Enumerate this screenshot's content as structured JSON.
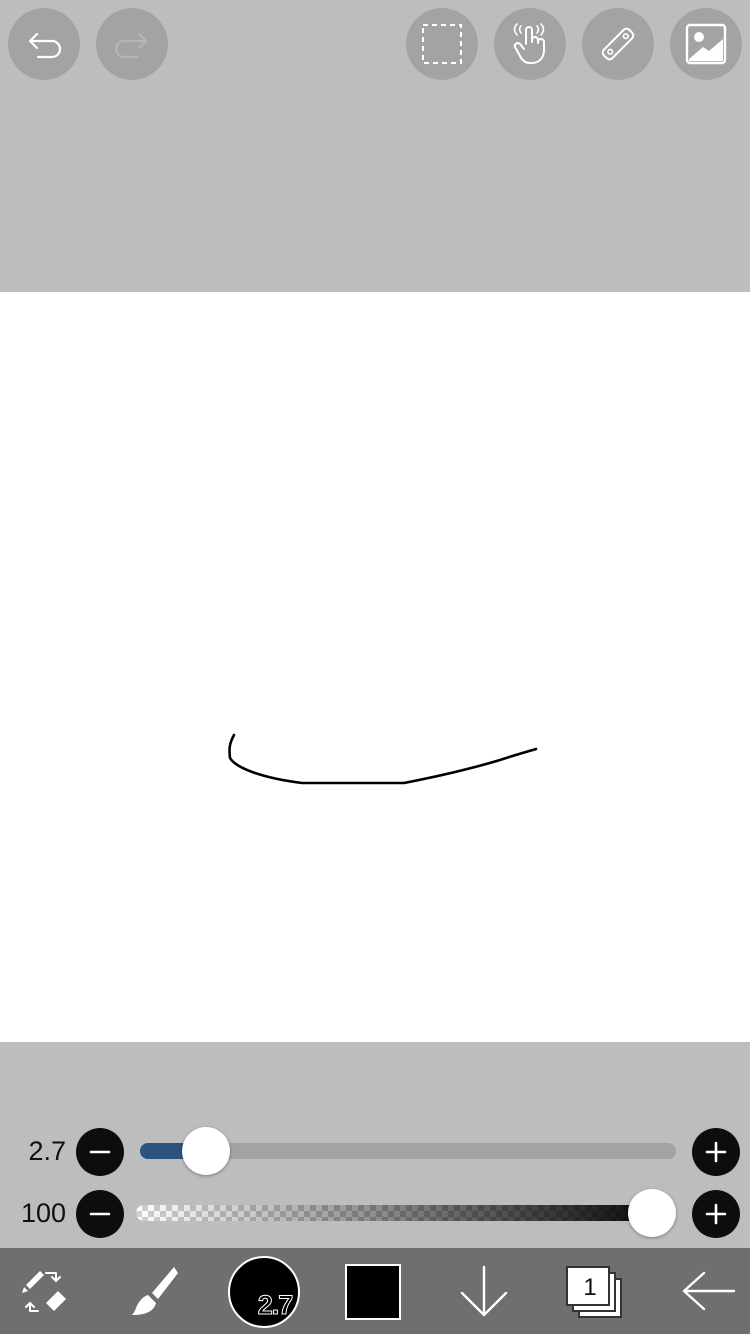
{
  "toolbar_top": {
    "undo": {
      "icon": "undo-arrow-icon",
      "enabled": true
    },
    "redo": {
      "icon": "redo-arrow-icon",
      "enabled": false
    },
    "select": {
      "icon": "dashed-selection-icon"
    },
    "hand": {
      "icon": "touch-hand-icon"
    },
    "ruler": {
      "icon": "ruler-icon"
    },
    "image": {
      "icon": "image-import-icon"
    }
  },
  "canvas": {
    "background": "#ffffff",
    "stroke_color": "#000000"
  },
  "sliders": {
    "brush_size": {
      "value_label": "2.7",
      "value": 2.7,
      "fill_fraction": 0.12,
      "fill_color": "#2c5380"
    },
    "opacity": {
      "value_label": "100",
      "value": 100,
      "fill_fraction": 1.0
    }
  },
  "toolbar_bottom": {
    "tool_switch": {
      "icon": "brush-eraser-swap-icon"
    },
    "brush": {
      "icon": "paintbrush-icon"
    },
    "brush_size_label": "2.7",
    "current_color": "#000000",
    "download": {
      "icon": "down-arrow-icon"
    },
    "layers_count": "1",
    "back": {
      "icon": "back-arrow-icon"
    }
  },
  "colors": {
    "panel_gray": "#bdbdbd",
    "button_gray": "#a3a3a3",
    "bottom_bar": "#6f6f6f",
    "accent_blue": "#2c5380"
  }
}
